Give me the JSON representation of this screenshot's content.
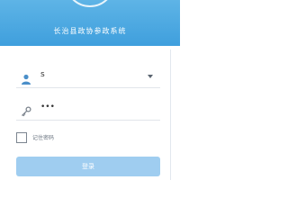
{
  "header": {
    "app_title": "长治县政协参政系统"
  },
  "login_form": {
    "username": {
      "icon": "user-icon",
      "value": "s"
    },
    "password": {
      "icon": "key-icon",
      "masked_value": "•••"
    },
    "remember": {
      "label": "记住密码",
      "checked": false
    },
    "submit_label": "登录"
  },
  "colors": {
    "header_blue": "#4aa6e0",
    "button_blue": "#9fcdf0",
    "field_border": "#e1e5ea"
  }
}
